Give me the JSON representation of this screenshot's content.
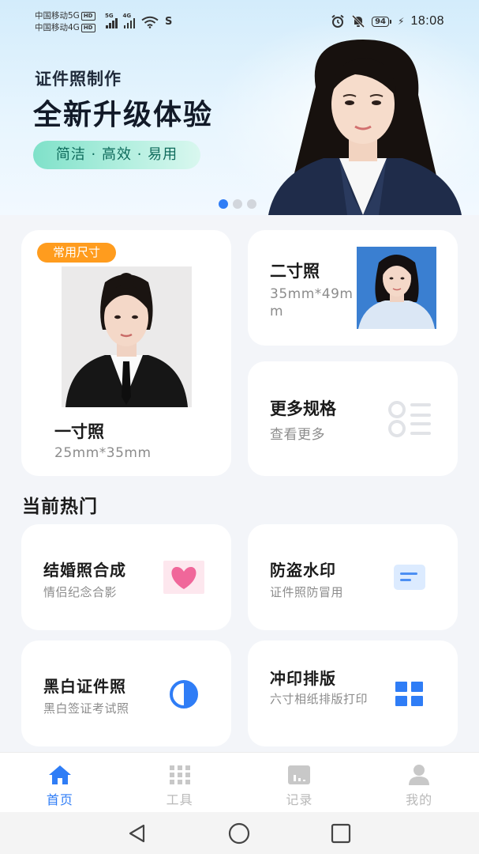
{
  "status_bar": {
    "carrier1": "中国移动5G",
    "carrier2": "中国移动4G",
    "hd": "HD",
    "net1": "5G",
    "net2": "4G",
    "battery": "94",
    "time": "18:08"
  },
  "hero": {
    "subtitle": "证件照制作",
    "title": "全新升级体验",
    "tagline": "简洁 · 高效 · 易用",
    "slides": 3,
    "active_slide": 1
  },
  "sizes": {
    "one": {
      "badge": "常用尺寸",
      "title": "一寸照",
      "dims": "25mm*35mm"
    },
    "two": {
      "title": "二寸照",
      "dims": "35mm*49mm"
    },
    "more": {
      "title": "更多规格",
      "sub": "查看更多"
    }
  },
  "hot": {
    "title": "当前热门",
    "items": [
      {
        "title": "结婚照合成",
        "sub": "情侣纪念合影",
        "icon": "heart-icon"
      },
      {
        "title": "防盗水印",
        "sub": "证件照防冒用",
        "icon": "document-lines-icon"
      },
      {
        "title": "黑白证件照",
        "sub": "黑白签证考试照",
        "icon": "half-circle-icon"
      },
      {
        "title": "冲印排版",
        "sub": "六寸相纸排版打印",
        "icon": "grid-icon"
      }
    ]
  },
  "nav": {
    "items": [
      {
        "label": "首页",
        "icon": "home-icon",
        "active": true
      },
      {
        "label": "工具",
        "icon": "apps-grid-icon",
        "active": false
      },
      {
        "label": "记录",
        "icon": "chart-record-icon",
        "active": false
      },
      {
        "label": "我的",
        "icon": "user-icon",
        "active": false
      }
    ]
  },
  "colors": {
    "accent": "#2f7df6",
    "badge": "#ff9c1e",
    "heart": "#f0679a",
    "pill_text": "#0f6b5c"
  }
}
